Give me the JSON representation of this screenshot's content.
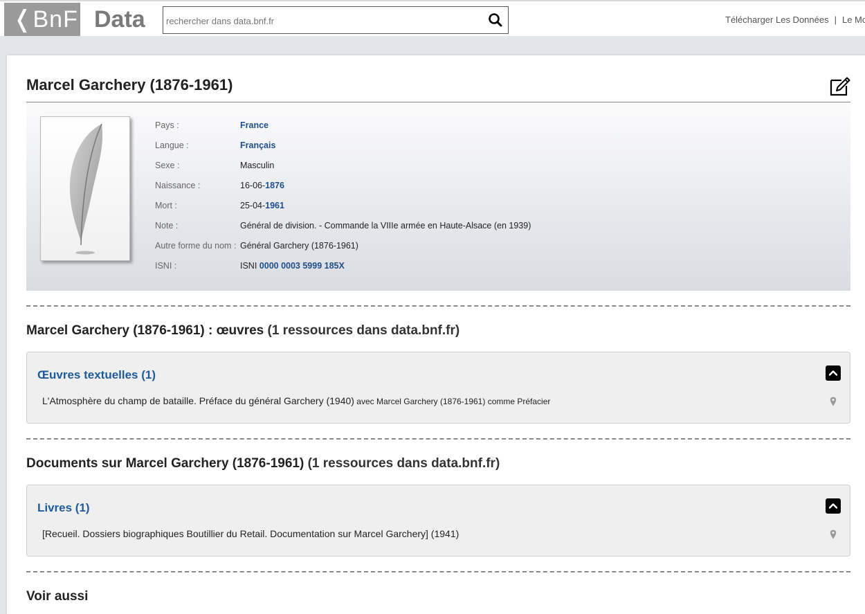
{
  "header": {
    "logo_text": "❬BnF",
    "data_text": "Data",
    "search_placeholder": "rechercher dans data.bnf.fr",
    "nav": [
      "Télécharger Les Données",
      "|",
      "Le Mod"
    ]
  },
  "page": {
    "title": "Marcel Garchery (1876-1961)"
  },
  "info": {
    "pays_label": "Pays :",
    "pays_value": "France",
    "langue_label": "Langue :",
    "langue_value": "Français",
    "sexe_label": "Sexe :",
    "sexe_value": "Masculin",
    "naissance_label": "Naissance :",
    "naissance_prefix": "16-06-",
    "naissance_year": "1876",
    "mort_label": "Mort :",
    "mort_prefix": "25-04-",
    "mort_year": "1961",
    "note_label": "Note :",
    "note_value": "Général de division. - Commande la VIIIe armée en Haute-Alsace (en 1939)",
    "autre_label": "Autre forme du nom :",
    "autre_value": "Général Garchery (1876-1961)",
    "isni_label": "ISNI :",
    "isni_prefix": "ISNI ",
    "isni_value": "0000 0003 5999 185X"
  },
  "oeuvres": {
    "title_bold": "Marcel Garchery (1876-1961) : œuvres",
    "title_count": " (1 ressources dans data.bnf.fr)",
    "panel_title": "Œuvres textuelles (1)",
    "item_main": "L'Atmosphère du champ de bataille. Préface du général Garchery (1940)",
    "item_small": " avec Marcel Garchery (1876-1961) comme Préfacier"
  },
  "documents": {
    "title_bold": "Documents sur Marcel Garchery (1876-1961)",
    "title_count": " (1 ressources dans data.bnf.fr)",
    "panel_title": "Livres (1)",
    "item_main": "[Recueil. Dossiers biographiques Boutillier du Retail. Documentation sur Marcel Garchery] (1941)"
  },
  "voir_aussi": "Voir aussi",
  "colors": {
    "link": "#1f4e8c",
    "panel_title": "#1f5a9a",
    "logo_bg": "#9a9a9a"
  }
}
